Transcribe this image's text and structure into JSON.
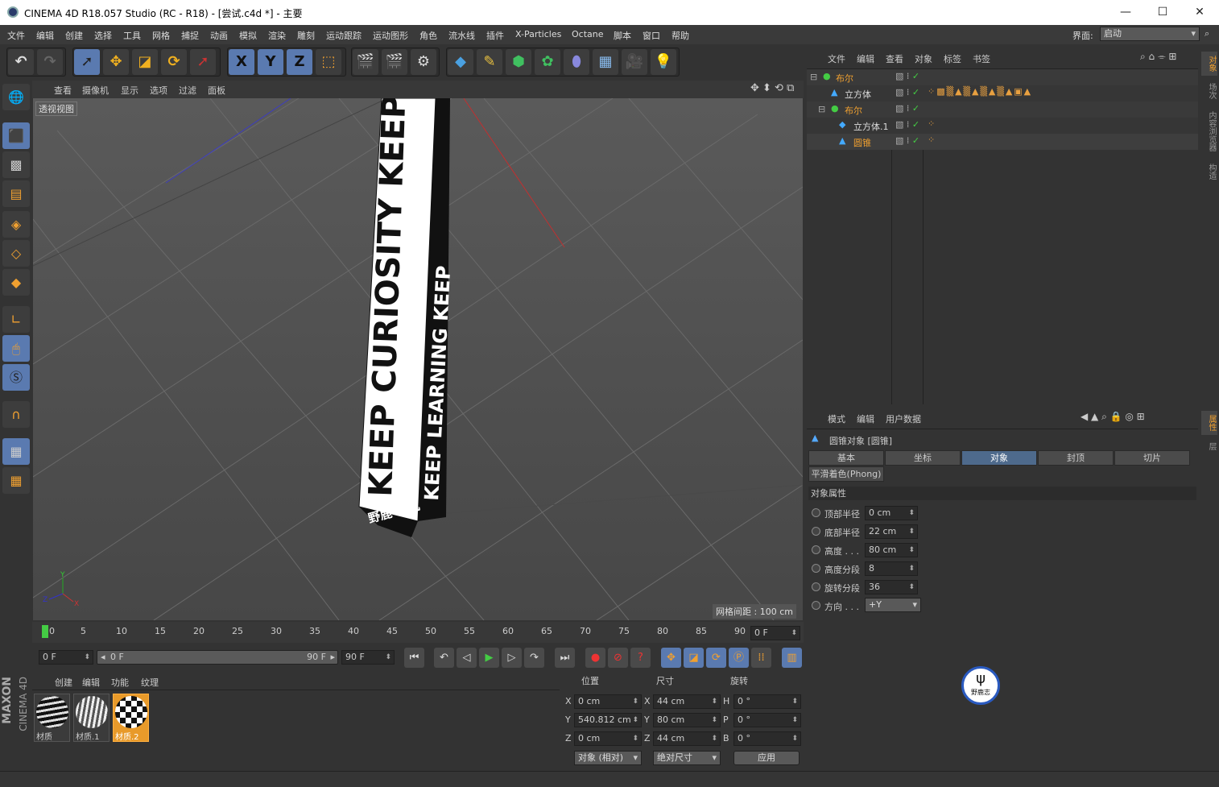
{
  "title": "CINEMA 4D R18.057 Studio (RC - R18) - [尝试.c4d *] - 主要",
  "menu": [
    "文件",
    "编辑",
    "创建",
    "选择",
    "工具",
    "网格",
    "捕捉",
    "动画",
    "模拟",
    "渲染",
    "雕刻",
    "运动跟踪",
    "运动图形",
    "角色",
    "流水线",
    "插件",
    "X-Particles",
    "Octane",
    "脚本",
    "窗口",
    "帮助"
  ],
  "layout_label": "界面:",
  "layout_value": "启动",
  "axis_buttons": [
    "X",
    "Y",
    "Z"
  ],
  "viewport": {
    "menu": [
      "查看",
      "摄像机",
      "显示",
      "选项",
      "过滤",
      "面板"
    ],
    "label": "透视视图",
    "grid_info": "网格间距 : 100 cm",
    "text_left": "KEEP CURIOSITY KEEP",
    "text_right": "KEEP LEARNING KEEP",
    "text_bottom": "野鹿 司机"
  },
  "timeline": {
    "ticks": [
      "0",
      "5",
      "10",
      "15",
      "20",
      "25",
      "30",
      "35",
      "40",
      "45",
      "50",
      "55",
      "60",
      "65",
      "70",
      "75",
      "80",
      "85",
      "90"
    ],
    "frame_display": "0 F"
  },
  "transport": {
    "start": "0 F",
    "range_start": "0 F",
    "range_end": "90 F",
    "end": "90 F"
  },
  "materials": {
    "menu": [
      "创建",
      "编辑",
      "功能",
      "纹理"
    ],
    "items": [
      "材质",
      "材质.1",
      "材质.2"
    ]
  },
  "coords": {
    "headers": [
      "位置",
      "尺寸",
      "旋转"
    ],
    "rows": [
      {
        "a": "X",
        "pos": "0 cm",
        "b": "X",
        "size": "44 cm",
        "c": "H",
        "rot": "0 °"
      },
      {
        "a": "Y",
        "pos": "540.812 cm",
        "b": "Y",
        "size": "80 cm",
        "c": "P",
        "rot": "0 °"
      },
      {
        "a": "Z",
        "pos": "0 cm",
        "b": "Z",
        "size": "44 cm",
        "c": "B",
        "rot": "0 °"
      }
    ],
    "mode": "对象 (相对)",
    "size_mode": "绝对尺寸",
    "apply": "应用"
  },
  "objmgr": {
    "menu": [
      "文件",
      "编辑",
      "查看",
      "对象",
      "标签",
      "书签"
    ],
    "objects": [
      "布尔",
      "立方体",
      "布尔",
      "立方体.1",
      "圆锥"
    ]
  },
  "attrmgr": {
    "menu": [
      "模式",
      "编辑",
      "用户数据"
    ],
    "object_title": "圆锥对象 [圆锥]",
    "tabs": [
      "基本",
      "坐标",
      "对象",
      "封顶",
      "切片"
    ],
    "phong": "平滑着色(Phong)",
    "section": "对象属性",
    "props": [
      {
        "label": "顶部半径",
        "value": "0 cm"
      },
      {
        "label": "底部半径",
        "value": "22 cm"
      },
      {
        "label": "高度 . . .",
        "value": "80 cm"
      },
      {
        "label": "高度分段",
        "value": "8"
      },
      {
        "label": "旋转分段",
        "value": "36"
      },
      {
        "label": "方向 . . .",
        "value": "+Y"
      }
    ]
  },
  "right_tabs": [
    "对象",
    "场次",
    "内容浏览器",
    "构造",
    "属性",
    "层"
  ],
  "brand": [
    "MAXON",
    "CINEMA 4D"
  ],
  "watermark": "野鹿志"
}
